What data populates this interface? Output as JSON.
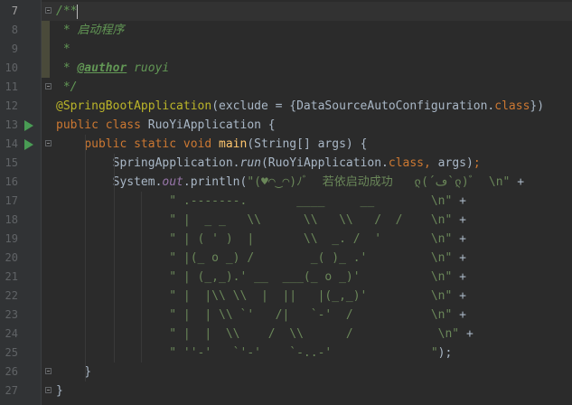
{
  "editor": {
    "lines": [
      {
        "num": "7",
        "segments": [
          {
            "t": "/**",
            "c": "cm"
          }
        ]
      },
      {
        "num": "8",
        "segments": [
          {
            "t": " * 启动程序",
            "c": "cm"
          }
        ]
      },
      {
        "num": "9",
        "segments": [
          {
            "t": " *",
            "c": "cm"
          }
        ]
      },
      {
        "num": "10",
        "segments": [
          {
            "t": " * ",
            "c": "cm"
          },
          {
            "t": "@author",
            "c": "cmtag"
          },
          {
            "t": " ruoyi",
            "c": "cm"
          }
        ]
      },
      {
        "num": "11",
        "segments": [
          {
            "t": " */",
            "c": "cm"
          }
        ]
      },
      {
        "num": "12",
        "segments": [
          {
            "t": "@SpringBootApplication",
            "c": "ann"
          },
          {
            "t": "(exclude = {DataSourceAutoConfiguration.",
            "c": ""
          },
          {
            "t": "class",
            "c": "kw"
          },
          {
            "t": "})",
            "c": ""
          }
        ]
      },
      {
        "num": "13",
        "segments": [
          {
            "t": "public class ",
            "c": "kw"
          },
          {
            "t": "RuoYiApplication {",
            "c": ""
          }
        ]
      },
      {
        "num": "14",
        "segments": [
          {
            "t": "    ",
            "c": ""
          },
          {
            "t": "public static void ",
            "c": "kw"
          },
          {
            "t": "main",
            "c": "fn"
          },
          {
            "t": "(String[] args) {",
            "c": ""
          }
        ]
      },
      {
        "num": "15",
        "segments": [
          {
            "t": "        SpringApplication.",
            "c": ""
          },
          {
            "t": "run",
            "c": "italic"
          },
          {
            "t": "(RuoYiApplication.",
            "c": ""
          },
          {
            "t": "class",
            "c": "kw"
          },
          {
            "t": ", ",
            "c": "kw"
          },
          {
            "t": "args)",
            "c": ""
          },
          {
            "t": ";",
            "c": "kw"
          }
        ]
      },
      {
        "num": "16",
        "segments": [
          {
            "t": "        System.",
            "c": ""
          },
          {
            "t": "out",
            "c": "field"
          },
          {
            "t": ".println(",
            "c": ""
          },
          {
            "t": "\"(♥◠‿◠)ﾉﾞ  若依启动成功   ლ(´ڡ`ლ)ﾞ  \\n\" ",
            "c": "str"
          },
          {
            "t": "+",
            "c": ""
          }
        ]
      },
      {
        "num": "17",
        "segments": [
          {
            "t": "                \" .-------.       ____     __        \\n\" ",
            "c": "str"
          },
          {
            "t": "+",
            "c": ""
          }
        ]
      },
      {
        "num": "18",
        "segments": [
          {
            "t": "                \" |  _ _   \\\\      \\\\   \\\\   /  /    \\n\" ",
            "c": "str"
          },
          {
            "t": "+",
            "c": ""
          }
        ]
      },
      {
        "num": "19",
        "segments": [
          {
            "t": "                \" | ( ' )  |       \\\\  _. /  '       \\n\" ",
            "c": "str"
          },
          {
            "t": "+",
            "c": ""
          }
        ]
      },
      {
        "num": "20",
        "segments": [
          {
            "t": "                \" |(_ o _) /        _( )_ .'         \\n\" ",
            "c": "str"
          },
          {
            "t": "+",
            "c": ""
          }
        ]
      },
      {
        "num": "21",
        "segments": [
          {
            "t": "                \" | (_,_).' __  ___(_ o _)'          \\n\" ",
            "c": "str"
          },
          {
            "t": "+",
            "c": ""
          }
        ]
      },
      {
        "num": "22",
        "segments": [
          {
            "t": "                \" |  |\\\\ \\\\  |  ||   |(_,_)'         \\n\" ",
            "c": "str"
          },
          {
            "t": "+",
            "c": ""
          }
        ]
      },
      {
        "num": "23",
        "segments": [
          {
            "t": "                \" |  | \\\\ `'   /|   `-'  /           \\n\" ",
            "c": "str"
          },
          {
            "t": "+",
            "c": ""
          }
        ]
      },
      {
        "num": "24",
        "segments": [
          {
            "t": "                \" |  |  \\\\    /  \\\\      /            \\n\" ",
            "c": "str"
          },
          {
            "t": "+",
            "c": ""
          }
        ]
      },
      {
        "num": "25",
        "segments": [
          {
            "t": "                \" ''-'   `'-'    `-..-'              \"",
            "c": "str"
          },
          {
            "t": ");",
            "c": ""
          }
        ]
      },
      {
        "num": "26",
        "segments": [
          {
            "t": "    }",
            "c": ""
          }
        ]
      },
      {
        "num": "27",
        "segments": [
          {
            "t": "}",
            "c": ""
          }
        ]
      }
    ]
  },
  "colors": {
    "background": "#2b2b2b",
    "comment": "#629755",
    "keyword": "#cc7832",
    "annotation": "#bbb529",
    "string": "#6a8759",
    "method": "#ffc66d",
    "field": "#9876aa",
    "run_icon": "#499c54"
  },
  "icons": {
    "run_lines": [
      "13",
      "14"
    ],
    "fold_lines": [
      "7",
      "11",
      "14",
      "26",
      "27"
    ],
    "run_icon_name": "run-gutter-icon",
    "fold_icon_name": "fold-marker-icon"
  }
}
